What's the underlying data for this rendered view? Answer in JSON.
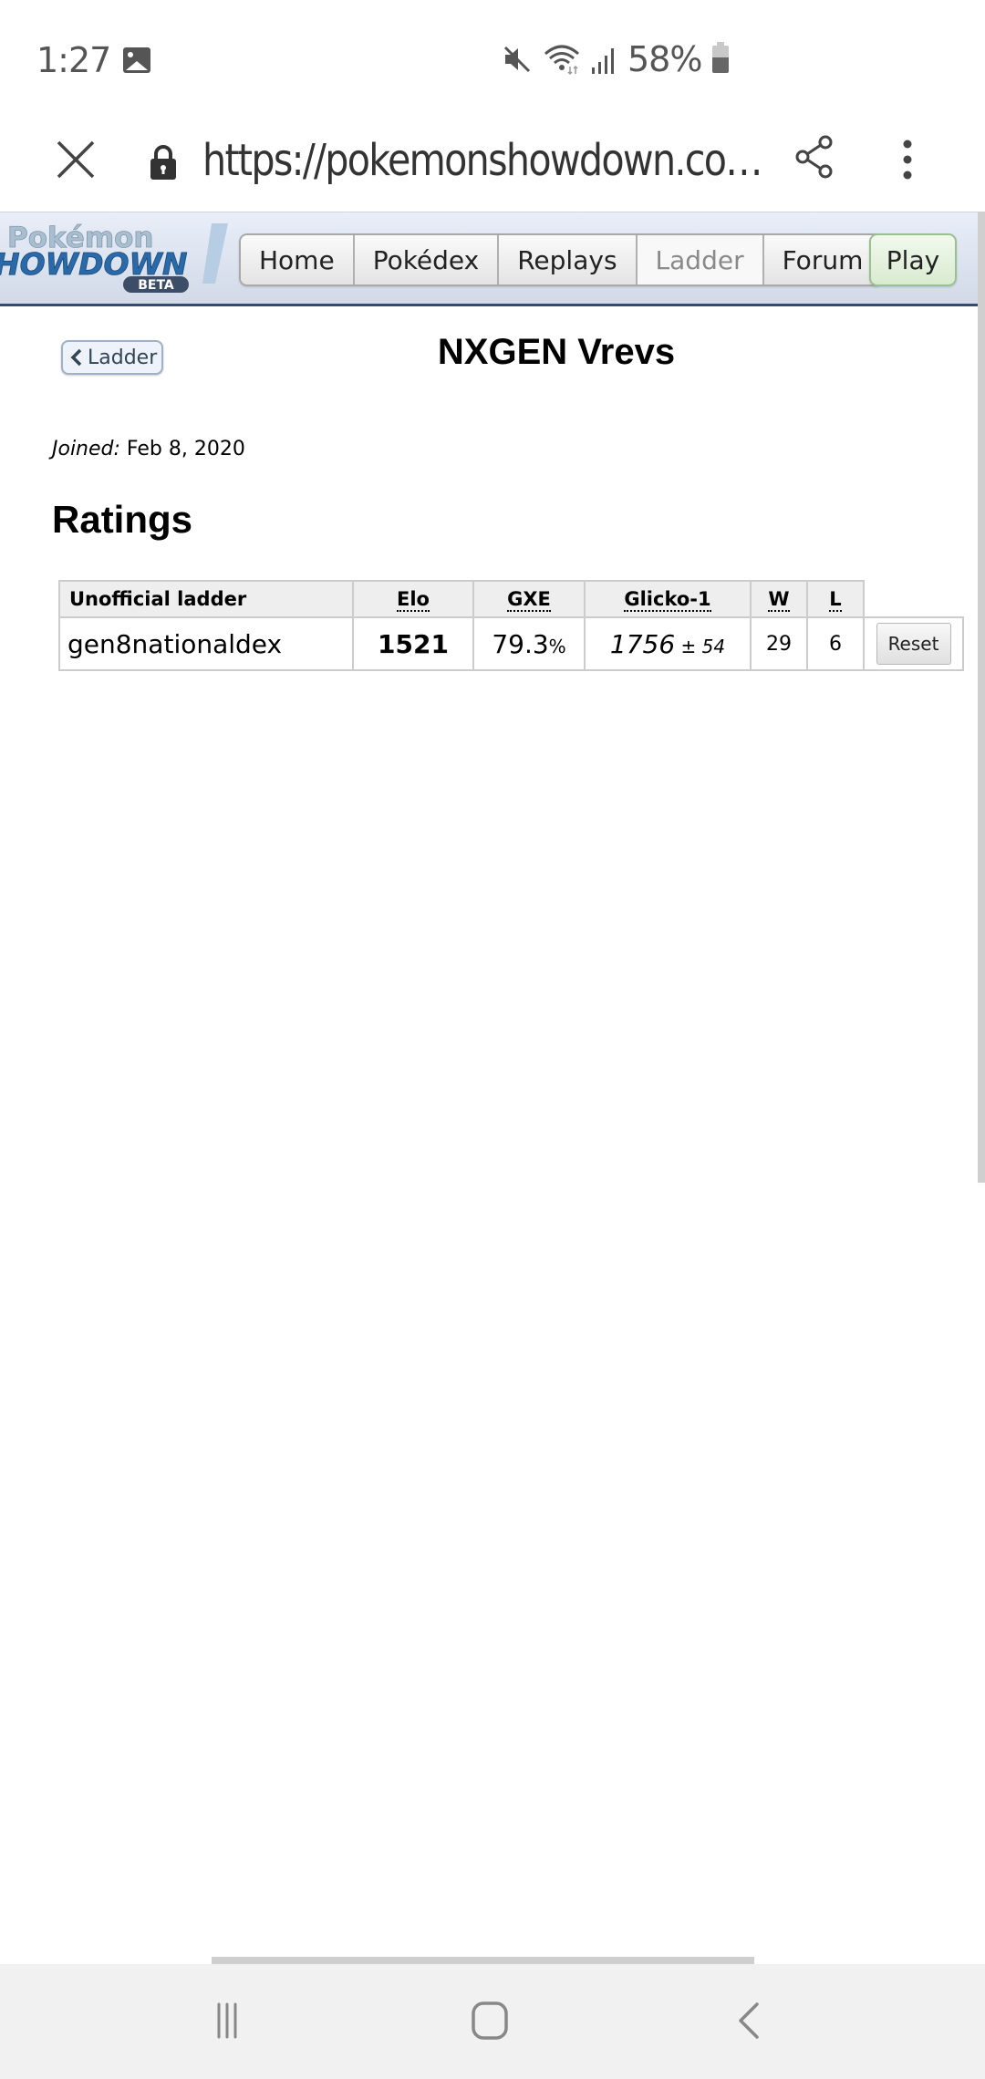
{
  "status_bar": {
    "time": "1:27",
    "battery_percent": "58%",
    "battery_level": 0.58,
    "icons": [
      "gallery-icon",
      "mute-icon",
      "wifi-icon",
      "signal-icon",
      "battery-icon"
    ]
  },
  "browser": {
    "url": "https://pokemonshowdown.co…",
    "icons": [
      "close-icon",
      "lock-icon",
      "share-icon",
      "more-vert-icon"
    ]
  },
  "header": {
    "logo_alt": "Pokémon Showdown! BETA",
    "nav": [
      {
        "label": "Home",
        "active": false
      },
      {
        "label": "Pokédex",
        "active": false
      },
      {
        "label": "Replays",
        "active": false
      },
      {
        "label": "Ladder",
        "active": true
      },
      {
        "label": "Forum",
        "active": false
      }
    ],
    "play_label": "Play"
  },
  "page": {
    "back_label": "Ladder",
    "title": "NXGEN Vrevs",
    "joined_label": "Joined:",
    "joined_value": " Feb 8, 2020",
    "ratings_heading": "Ratings"
  },
  "ratings_table": {
    "headers": [
      "Unofficial ladder",
      "Elo",
      "GXE",
      "Glicko-1",
      "W",
      "L"
    ],
    "rows": [
      {
        "format": "gen8nationaldex",
        "elo": "1521",
        "gxe": "79.3",
        "gxe_unit": "%",
        "glicko": "1756",
        "glicko_dev": " ± 54",
        "wins": "29",
        "losses": "6",
        "action_label": "Reset"
      }
    ]
  },
  "colors": {
    "header_border": "#344a6e",
    "play_border": "#98c090",
    "table_border": "#cccccc",
    "table_header_bg": "#eeeeee"
  }
}
